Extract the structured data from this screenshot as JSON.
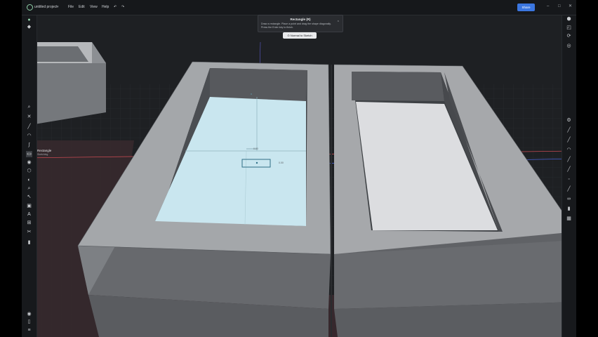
{
  "topbar": {
    "project_name": "untitled project",
    "menu": [
      "File",
      "Edit",
      "View",
      "Help"
    ],
    "share_label": "Share"
  },
  "tooltip": {
    "title": "Rectangle (R)",
    "desc_line1": "Draw a rectangle. Place a point and drag the shape diagonally.",
    "desc_line2": "Press the Enter key to finish."
  },
  "sketch_button": {
    "label": "Normal to Sketch"
  },
  "tool_label": {
    "name": "Rectangle",
    "sub": "Sketching"
  },
  "dimension_labels": [
    "0.00",
    "0.00"
  ],
  "icons": {
    "left_rail": [
      "search-icon",
      "close-icon",
      "line-icon",
      "arc-icon",
      "rectangle-icon",
      "circle-icon",
      "polygon-icon",
      "sphere-icon",
      "zoom-icon",
      "pointer-icon",
      "image-icon",
      "text-icon",
      "stamp-icon",
      "stack-icon",
      "scissors-icon",
      "trash-icon"
    ],
    "right_rail": [
      "cube-nav-icon",
      "gear-icon",
      "pen-icon",
      "brush-icon",
      "undo-arc-icon",
      "pencil-icon",
      "pencil-alt-icon",
      "pencil-fine-icon",
      "layers-icon",
      "link-icon",
      "lock-icon",
      "grid-icon"
    ]
  },
  "colors": {
    "accent": "#3b76e0",
    "selected_face": "#c9e6ef",
    "bg": "#1f2124"
  }
}
